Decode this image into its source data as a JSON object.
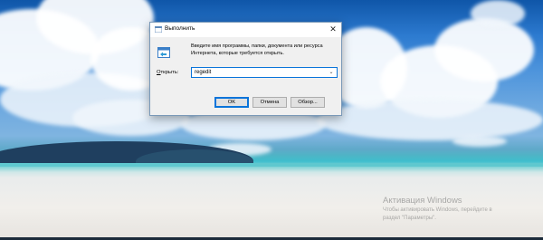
{
  "dialog": {
    "title": "Выполнить",
    "description": "Введите имя программы, папки, документа или ресурса Интернета, которые требуется открыть.",
    "open_label_underlined": "О",
    "open_label_rest": "ткрыть:",
    "input_value": "regedit",
    "buttons": {
      "ok": "OK",
      "cancel": "Отмена",
      "browse": "Обзор..."
    },
    "close_glyph": "✕",
    "dropdown_glyph": "⌄"
  },
  "watermark": {
    "title": "Активация Windows",
    "subtitle_line1": "Чтобы активировать Windows, перейдите в",
    "subtitle_line2": "раздел \"Параметры\"."
  },
  "icons": {
    "app_icon": "run-icon",
    "close": "close-icon",
    "dropdown": "chevron-down-icon"
  },
  "colors": {
    "accent": "#0a74da",
    "dialog_bg": "#f0f0f0"
  }
}
